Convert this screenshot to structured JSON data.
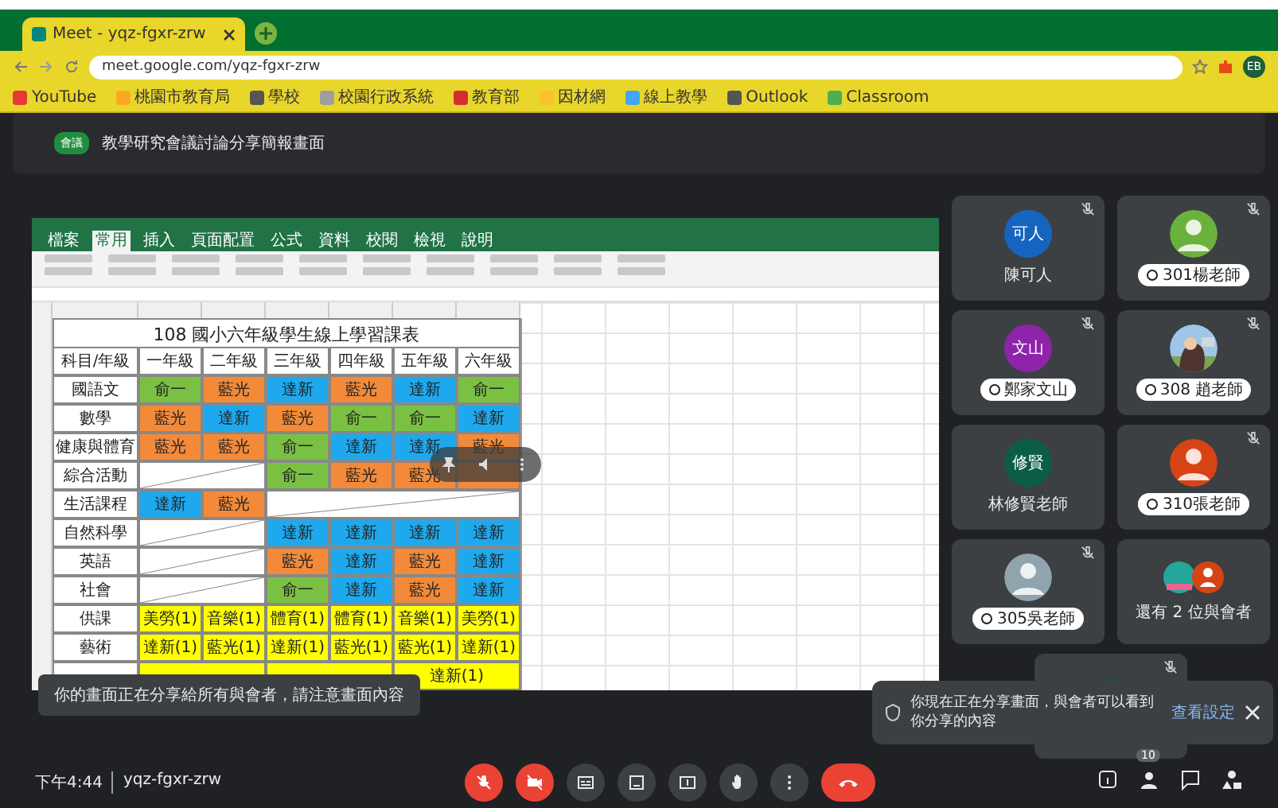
{
  "browser": {
    "tab": {
      "title": "Meet - yqz-fgxr-zrw"
    },
    "url": "meet.google.com/yqz-fgxr-zrw",
    "profile": "EB",
    "bookmarks": [
      "YouTube",
      "桃園市教育局",
      "學校",
      "校園行政系統",
      "教育部",
      "因材網",
      "線上教學",
      "Outlook",
      "Classroom"
    ]
  },
  "meeting": {
    "badge": "會議",
    "title": "教學研究會議討論分享簡報畫面"
  },
  "excel": {
    "tabs": [
      {
        "label": "檔案",
        "selected": false
      },
      {
        "label": "常用",
        "selected": true
      },
      {
        "label": "插入",
        "selected": false
      },
      {
        "label": "頁面配置",
        "selected": false
      },
      {
        "label": "公式",
        "selected": false
      },
      {
        "label": "資料",
        "selected": false
      },
      {
        "label": "校閱",
        "selected": false
      },
      {
        "label": "檢視",
        "selected": false
      },
      {
        "label": "說明",
        "selected": false
      }
    ],
    "sheet_title": "108 國小六年級學生線上學習課表",
    "header": [
      "科目/年級",
      "一年級",
      "二年級",
      "三年級",
      "四年級",
      "五年級",
      "六年級"
    ],
    "rows": [
      {
        "label": "國語文",
        "cells": [
          {
            "kind": "fill",
            "text": "俞一",
            "color": "#7ac143"
          },
          {
            "kind": "fill",
            "text": "藍光",
            "color": "#f28a3a"
          },
          {
            "kind": "fill",
            "text": "達新",
            "color": "#1ea9ee"
          },
          {
            "kind": "fill",
            "text": "藍光",
            "color": "#f28a3a"
          },
          {
            "kind": "fill",
            "text": "達新",
            "color": "#1ea9ee"
          },
          {
            "kind": "fill",
            "text": "俞一",
            "color": "#7ac143"
          }
        ]
      },
      {
        "label": "數學",
        "cells": [
          {
            "kind": "fill",
            "text": "藍光",
            "color": "#f28a3a"
          },
          {
            "kind": "fill",
            "text": "達新",
            "color": "#1ea9ee"
          },
          {
            "kind": "fill",
            "text": "藍光",
            "color": "#f28a3a"
          },
          {
            "kind": "fill",
            "text": "俞一",
            "color": "#7ac143"
          },
          {
            "kind": "fill",
            "text": "俞一",
            "color": "#7ac143"
          },
          {
            "kind": "fill",
            "text": "達新",
            "color": "#1ea9ee"
          }
        ]
      },
      {
        "label": "健康與體育",
        "cells": [
          {
            "kind": "fill",
            "text": "藍光",
            "color": "#f28a3a"
          },
          {
            "kind": "fill",
            "text": "藍光",
            "color": "#f28a3a"
          },
          {
            "kind": "fill",
            "text": "俞一",
            "color": "#7ac143"
          },
          {
            "kind": "fill",
            "text": "達新",
            "color": "#1ea9ee"
          },
          {
            "kind": "fill",
            "text": "達新",
            "color": "#1ea9ee"
          },
          {
            "kind": "fill",
            "text": "藍光",
            "color": "#f28a3a"
          }
        ]
      },
      {
        "label": "綜合活動",
        "cells": [
          {
            "kind": "slash-pair"
          },
          {
            "kind": "fill",
            "text": "俞一",
            "color": "#7ac143"
          },
          {
            "kind": "fill",
            "text": "藍光",
            "color": "#f28a3a"
          },
          {
            "kind": "fill",
            "text": "藍光",
            "color": "#f28a3a"
          },
          {
            "kind": "fill",
            "color": "#f28a3a"
          }
        ]
      },
      {
        "label": "生活課程",
        "cells": [
          {
            "kind": "fill",
            "text": "達新",
            "color": "#1ea9ee"
          },
          {
            "kind": "fill",
            "text": "藍光",
            "color": "#f28a3a"
          },
          {
            "kind": "slash-wide"
          }
        ]
      },
      {
        "label": "自然科學",
        "cells": [
          {
            "kind": "slash-pair"
          },
          {
            "kind": "fill",
            "text": "達新",
            "color": "#1ea9ee"
          },
          {
            "kind": "fill",
            "text": "達新",
            "color": "#1ea9ee"
          },
          {
            "kind": "fill",
            "text": "達新",
            "color": "#1ea9ee"
          },
          {
            "kind": "fill",
            "text": "達新",
            "color": "#1ea9ee"
          }
        ]
      },
      {
        "label": "英語",
        "cells": [
          {
            "kind": "slash-pair"
          },
          {
            "kind": "fill",
            "text": "藍光",
            "color": "#f28a3a"
          },
          {
            "kind": "fill",
            "text": "達新",
            "color": "#1ea9ee"
          },
          {
            "kind": "fill",
            "text": "藍光",
            "color": "#f28a3a"
          },
          {
            "kind": "fill",
            "text": "達新",
            "color": "#1ea9ee"
          }
        ]
      },
      {
        "label": "社會",
        "cells": [
          {
            "kind": "slash-pair"
          },
          {
            "kind": "fill",
            "text": "俞一",
            "color": "#7ac143"
          },
          {
            "kind": "fill",
            "text": "達新",
            "color": "#1ea9ee"
          },
          {
            "kind": "fill",
            "text": "藍光",
            "color": "#f28a3a"
          },
          {
            "kind": "fill",
            "text": "達新",
            "color": "#1ea9ee"
          }
        ]
      },
      {
        "label": "供課",
        "cells": [
          {
            "kind": "fill",
            "text": "美勞(1)",
            "color": "#ffff00"
          },
          {
            "kind": "fill",
            "text": "音樂(1)",
            "color": "#ffff00"
          },
          {
            "kind": "fill",
            "text": "體育(1)",
            "color": "#ffff00"
          },
          {
            "kind": "fill",
            "text": "體育(1)",
            "color": "#ffff00"
          },
          {
            "kind": "fill",
            "text": "音樂(1)",
            "color": "#ffff00"
          },
          {
            "kind": "fill",
            "text": "美勞(1)",
            "color": "#ffff00"
          }
        ]
      },
      {
        "label": "藝術",
        "cells": [
          {
            "kind": "fill",
            "text": "達新(1)",
            "color": "#ffff00"
          },
          {
            "kind": "fill",
            "text": "藍光(1)",
            "color": "#ffff00"
          },
          {
            "kind": "fill",
            "text": "達新(1)",
            "color": "#ffff00"
          },
          {
            "kind": "fill",
            "text": "藍光(1)",
            "color": "#ffff00"
          },
          {
            "kind": "fill",
            "text": "藍光(1)",
            "color": "#ffff00"
          },
          {
            "kind": "fill",
            "text": "達新(1)",
            "color": "#ffff00"
          }
        ]
      },
      {
        "cells": [
          {
            "kind": "fill-pair",
            "color": "#ffff00"
          },
          {
            "kind": "fill-pair",
            "color": "#ffff00"
          },
          {
            "kind": "fill-pair",
            "text": "達新(1)",
            "color": "#ffff00"
          }
        ]
      }
    ]
  },
  "tiles": [
    {
      "kind": "initials",
      "initials": "可人",
      "color": "#1565c0",
      "name": "陳可人",
      "label_pill": false,
      "muted": true
    },
    {
      "kind": "silhouette",
      "color": "#6bb13d",
      "name": "301楊老師",
      "label_pill": true,
      "muted": true
    },
    {
      "kind": "initials",
      "initials": "文山",
      "color": "#8e24aa",
      "name": "鄭家文山",
      "label_pill": true,
      "muted": true
    },
    {
      "kind": "picture",
      "name": "308 趙老師",
      "label_pill": true,
      "muted": true
    },
    {
      "kind": "initials",
      "initials": "修賢",
      "color": "#0b5e45",
      "name": "林修賢老師",
      "label_pill": false,
      "muted": false
    },
    {
      "kind": "silhouette",
      "color": "#d84315",
      "name": "310張老師",
      "label_pill": true,
      "muted": true
    },
    {
      "kind": "silhouette",
      "color": "#90a4ae",
      "name": "305吳老師",
      "label_pill": true,
      "muted": true
    },
    {
      "kind": "pair",
      "color": "#d84315",
      "name": "還有 2 位與會者",
      "label_pill": false,
      "muted": false
    },
    {
      "kind": "blank",
      "color": "#0b5e45",
      "muted": true
    }
  ],
  "toast": "你的畫面正在分享給所有與會者，請注意畫面內容",
  "notice": {
    "text": "你現在正在分享畫面，與會者可以看到你分享的內容",
    "action": "查看設定"
  },
  "bottom": {
    "time": "下午4:44",
    "code": "yqz-fgxr-zrw",
    "controls": [
      {
        "kind": "mic",
        "on": false
      },
      {
        "kind": "camera",
        "on": false
      },
      {
        "kind": "captions",
        "on": true
      },
      {
        "kind": "reactions",
        "on": true
      },
      {
        "kind": "present",
        "on": true
      },
      {
        "kind": "hand",
        "on": true
      },
      {
        "kind": "more",
        "on": true
      },
      {
        "kind": "end"
      }
    ],
    "people_count": "10"
  }
}
